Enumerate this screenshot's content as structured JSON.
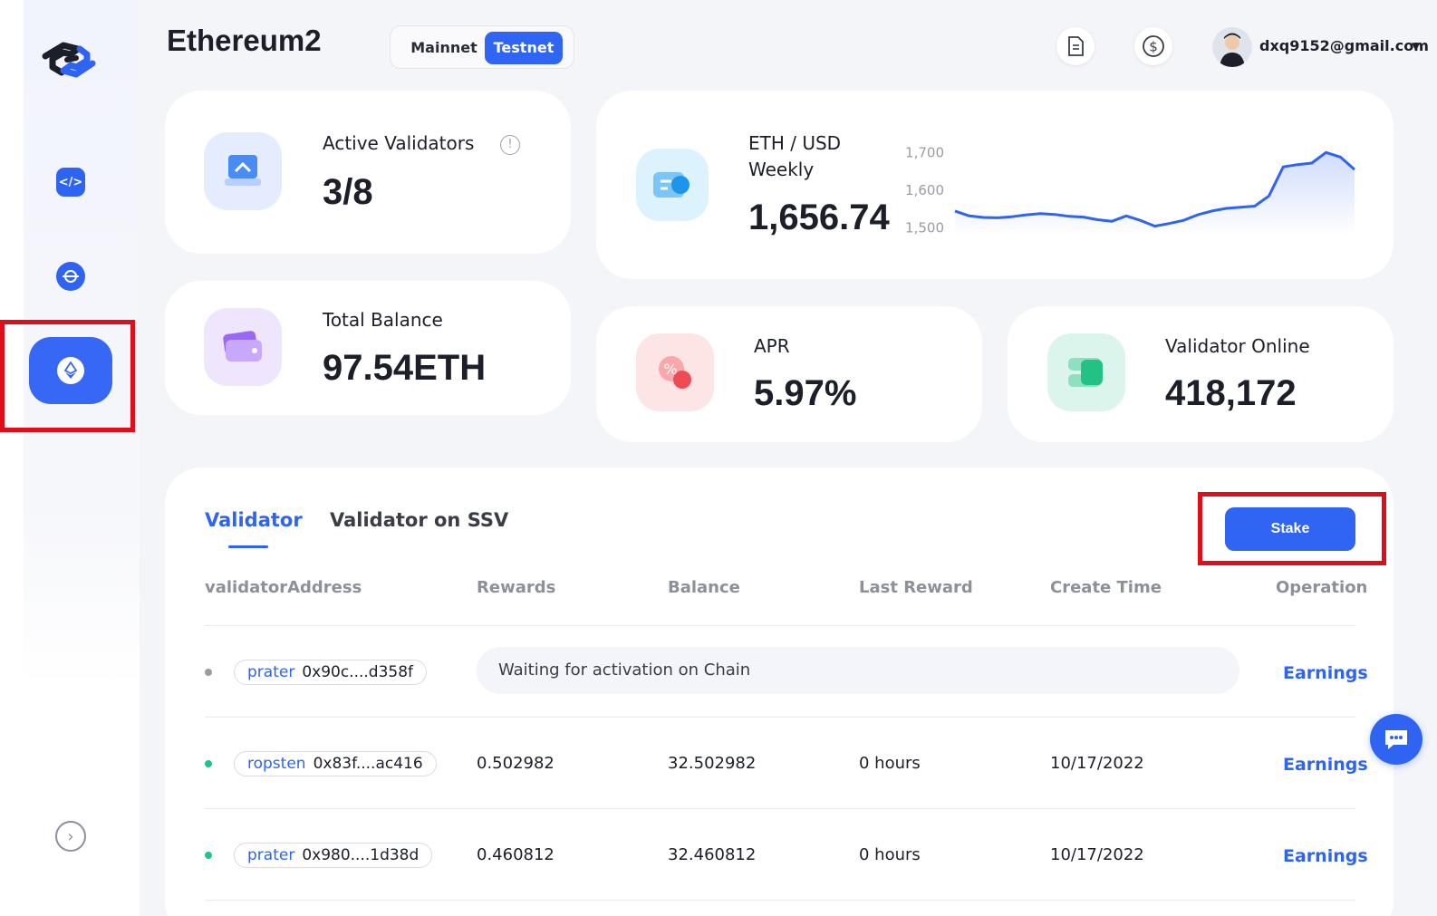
{
  "header": {
    "title": "Ethereum2",
    "network_options": [
      "Mainnet",
      "Testnet"
    ],
    "selected_network": "Testnet",
    "user_email": "dxq9152@gmail.com"
  },
  "stats": {
    "active_validators": {
      "label": "Active Validators",
      "value": "3/8"
    },
    "eth_usd": {
      "label_line1": "ETH / USD",
      "label_line2": "Weekly",
      "value": "1,656.74"
    },
    "total_balance": {
      "label": "Total Balance",
      "value": "97.54ETH"
    },
    "apr": {
      "label": "APR",
      "value": "5.97%"
    },
    "validator_online": {
      "label": "Validator Online",
      "value": "418,172"
    }
  },
  "chart_data": {
    "type": "line",
    "title": "",
    "xlabel": "",
    "ylabel": "",
    "yticks": [
      "1,700",
      "1,600",
      "1,500"
    ],
    "ylim": [
      1480,
      1720
    ],
    "values": [
      1545,
      1532,
      1528,
      1527,
      1530,
      1535,
      1538,
      1536,
      1531,
      1529,
      1522,
      1518,
      1532,
      1520,
      1505,
      1512,
      1520,
      1535,
      1545,
      1552,
      1555,
      1558,
      1585,
      1662,
      1668,
      1672,
      1700,
      1688,
      1655
    ],
    "line_color": "#2f63f2"
  },
  "tabs": [
    "Validator",
    "Validator on SSV"
  ],
  "active_tab": "Validator",
  "stake_label": "Stake",
  "table": {
    "headers": [
      "validatorAddress",
      "Rewards",
      "Balance",
      "Last Reward",
      "Create Time",
      "Operation"
    ],
    "rows": [
      {
        "network": "prater",
        "address": "0x90c....d358f",
        "waiting": "Waiting for activation on Chain",
        "operation": "Earnings",
        "status_color": "#9a9ca4"
      },
      {
        "network": "ropsten",
        "address": "0x83f....ac416",
        "rewards": "0.502982",
        "balance": "32.502982",
        "last_reward": "0 hours",
        "create_time": "10/17/2022",
        "operation": "Earnings",
        "status_color": "#20c48a"
      },
      {
        "network": "prater",
        "address": "0x980....1d38d",
        "rewards": "0.460812",
        "balance": "32.460812",
        "last_reward": "0 hours",
        "create_time": "10/17/2022",
        "operation": "Earnings",
        "status_color": "#20c48a"
      }
    ]
  },
  "colors": {
    "accent": "#2f63f2",
    "highlight": "#e20d1a"
  }
}
